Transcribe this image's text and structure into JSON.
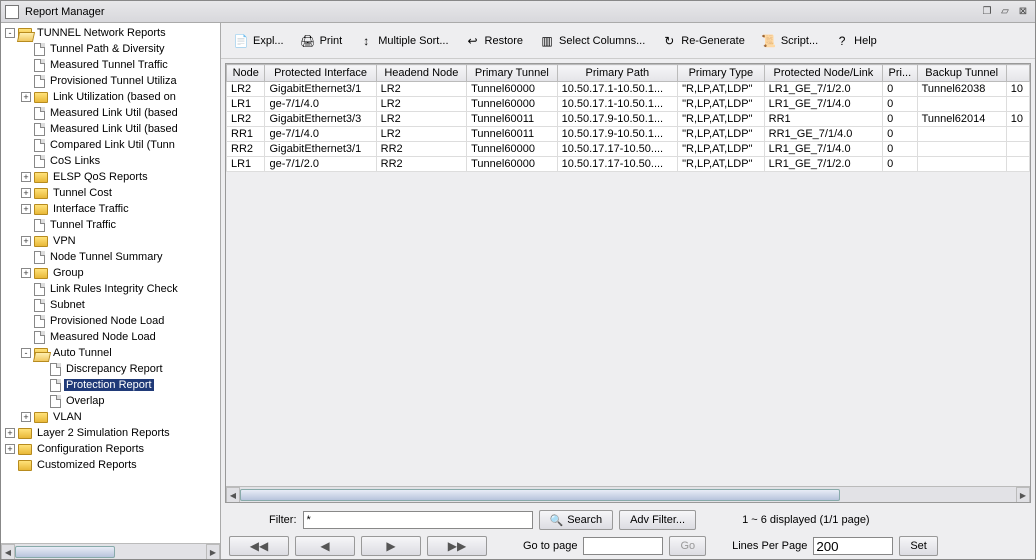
{
  "window": {
    "title": "Report Manager"
  },
  "sidebar": {
    "nodes": [
      {
        "depth": 0,
        "toggle": "-",
        "kind": "folder-open",
        "label": "TUNNEL Network Reports"
      },
      {
        "depth": 1,
        "toggle": "",
        "kind": "file",
        "label": "Tunnel Path & Diversity"
      },
      {
        "depth": 1,
        "toggle": "",
        "kind": "file",
        "label": "Measured Tunnel Traffic"
      },
      {
        "depth": 1,
        "toggle": "",
        "kind": "file",
        "label": "Provisioned Tunnel Utiliza"
      },
      {
        "depth": 1,
        "toggle": "+",
        "kind": "folder",
        "label": "Link Utilization (based on"
      },
      {
        "depth": 1,
        "toggle": "",
        "kind": "file",
        "label": "Measured Link Util (based"
      },
      {
        "depth": 1,
        "toggle": "",
        "kind": "file",
        "label": "Measured Link Util (based"
      },
      {
        "depth": 1,
        "toggle": "",
        "kind": "file",
        "label": "Compared Link Util (Tunn"
      },
      {
        "depth": 1,
        "toggle": "",
        "kind": "file",
        "label": "CoS Links"
      },
      {
        "depth": 1,
        "toggle": "+",
        "kind": "folder",
        "label": "ELSP QoS Reports"
      },
      {
        "depth": 1,
        "toggle": "+",
        "kind": "folder",
        "label": "Tunnel Cost"
      },
      {
        "depth": 1,
        "toggle": "+",
        "kind": "folder",
        "label": "Interface Traffic"
      },
      {
        "depth": 1,
        "toggle": "",
        "kind": "file",
        "label": "Tunnel Traffic"
      },
      {
        "depth": 1,
        "toggle": "+",
        "kind": "folder",
        "label": "VPN"
      },
      {
        "depth": 1,
        "toggle": "",
        "kind": "file",
        "label": "Node Tunnel Summary"
      },
      {
        "depth": 1,
        "toggle": "+",
        "kind": "folder",
        "label": "Group"
      },
      {
        "depth": 1,
        "toggle": "",
        "kind": "file",
        "label": "Link Rules Integrity Check"
      },
      {
        "depth": 1,
        "toggle": "",
        "kind": "file",
        "label": "Subnet"
      },
      {
        "depth": 1,
        "toggle": "",
        "kind": "file",
        "label": "Provisioned Node Load"
      },
      {
        "depth": 1,
        "toggle": "",
        "kind": "file",
        "label": "Measured Node Load"
      },
      {
        "depth": 1,
        "toggle": "-",
        "kind": "folder-open",
        "label": "Auto Tunnel"
      },
      {
        "depth": 2,
        "toggle": "",
        "kind": "file",
        "label": "Discrepancy Report"
      },
      {
        "depth": 2,
        "toggle": "",
        "kind": "file",
        "label": "Protection Report",
        "selected": true
      },
      {
        "depth": 2,
        "toggle": "",
        "kind": "file",
        "label": "Overlap"
      },
      {
        "depth": 1,
        "toggle": "+",
        "kind": "folder",
        "label": "VLAN"
      },
      {
        "depth": 0,
        "toggle": "+",
        "kind": "folder",
        "label": "Layer 2 Simulation Reports"
      },
      {
        "depth": 0,
        "toggle": "+",
        "kind": "folder",
        "label": "Configuration Reports"
      },
      {
        "depth": 0,
        "toggle": "",
        "kind": "folder",
        "label": "Customized Reports"
      }
    ]
  },
  "toolbar": {
    "buttons": [
      {
        "icon": "📄",
        "label": "Expl..."
      },
      {
        "icon": "🖨",
        "label": "Print"
      },
      {
        "icon": "↕",
        "label": "Multiple Sort..."
      },
      {
        "icon": "↩",
        "label": "Restore"
      },
      {
        "icon": "▥",
        "label": "Select Columns..."
      },
      {
        "icon": "↻",
        "label": "Re-Generate"
      },
      {
        "icon": "📜",
        "label": "Script..."
      },
      {
        "icon": "?",
        "label": "Help"
      }
    ]
  },
  "table": {
    "columns": [
      "Node",
      "Protected Interface",
      "Headend Node",
      "Primary Tunnel",
      "Primary Path",
      "Primary Type",
      "Protected Node/Link",
      "Pri...",
      "Backup Tunnel",
      ""
    ],
    "rows": [
      [
        "LR2",
        "GigabitEthernet3/1",
        "LR2",
        "Tunnel60000",
        "10.50.17.1-10.50.1...",
        "\"R,LP,AT,LDP\"",
        "LR1_GE_7/1/2.0",
        "0",
        "Tunnel62038",
        "10"
      ],
      [
        "LR1",
        "ge-7/1/4.0",
        "LR2",
        "Tunnel60000",
        "10.50.17.1-10.50.1...",
        "\"R,LP,AT,LDP\"",
        "LR1_GE_7/1/4.0",
        "0",
        "",
        ""
      ],
      [
        "LR2",
        "GigabitEthernet3/3",
        "LR2",
        "Tunnel60011",
        "10.50.17.9-10.50.1...",
        "\"R,LP,AT,LDP\"",
        "RR1",
        "0",
        "Tunnel62014",
        "10"
      ],
      [
        "RR1",
        "ge-7/1/4.0",
        "LR2",
        "Tunnel60011",
        "10.50.17.9-10.50.1...",
        "\"R,LP,AT,LDP\"",
        "RR1_GE_7/1/4.0",
        "0",
        "",
        ""
      ],
      [
        "RR2",
        "GigabitEthernet3/1",
        "RR2",
        "Tunnel60000",
        "10.50.17.17-10.50....",
        "\"R,LP,AT,LDP\"",
        "LR1_GE_7/1/4.0",
        "0",
        "",
        ""
      ],
      [
        "LR1",
        "ge-7/1/2.0",
        "RR2",
        "Tunnel60000",
        "10.50.17.17-10.50....",
        "\"R,LP,AT,LDP\"",
        "LR1_GE_7/1/2.0",
        "0",
        "",
        ""
      ]
    ]
  },
  "filter": {
    "label": "Filter:",
    "value": "*",
    "search": "Search",
    "adv": "Adv Filter...",
    "status": "1 ~ 6 displayed (1/1 page)"
  },
  "pager": {
    "gotolabel": "Go to page",
    "go": "Go",
    "lpplabel": "Lines Per Page",
    "lppvalue": "200",
    "set": "Set"
  }
}
